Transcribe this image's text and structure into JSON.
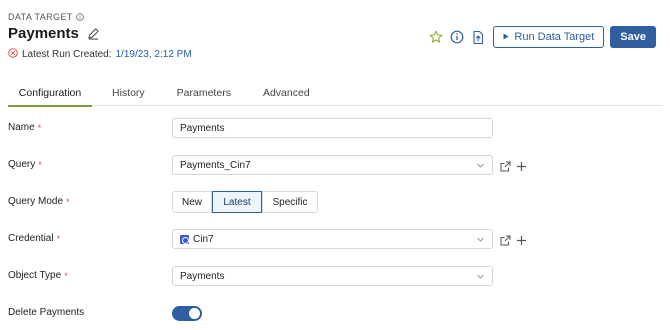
{
  "header": {
    "eyebrow": "DATA TARGET",
    "title": "Payments",
    "run_label": "Latest Run Created:",
    "run_value": "1/19/23, 2:12 PM"
  },
  "actions": {
    "run_label": "Run Data Target",
    "save_label": "Save"
  },
  "tabs": [
    {
      "label": "Configuration",
      "active": true
    },
    {
      "label": "History"
    },
    {
      "label": "Parameters"
    },
    {
      "label": "Advanced"
    }
  ],
  "form": {
    "name": {
      "label": "Name",
      "value": "Payments"
    },
    "query": {
      "label": "Query",
      "value": "Payments_Cin7"
    },
    "query_mode": {
      "label": "Query Mode",
      "options": [
        "New",
        "Latest",
        "Specific"
      ],
      "selected": "Latest"
    },
    "credential": {
      "label": "Credential",
      "value": "Cin7"
    },
    "object_type": {
      "label": "Object Type",
      "value": "Payments"
    },
    "delete_payments": {
      "label": "Delete Payments",
      "enabled": true
    }
  },
  "required_mark": "*",
  "colors": {
    "primary": "#2f5f9e",
    "tab_active": "#7a9d3a",
    "error": "#d9534f",
    "star": "#8ab22e"
  },
  "icons": [
    "info-icon",
    "edit-icon",
    "error-icon",
    "star-icon",
    "export-icon",
    "play-icon",
    "chevron-down-icon",
    "external-link-icon",
    "plus-icon",
    "credential-icon"
  ]
}
